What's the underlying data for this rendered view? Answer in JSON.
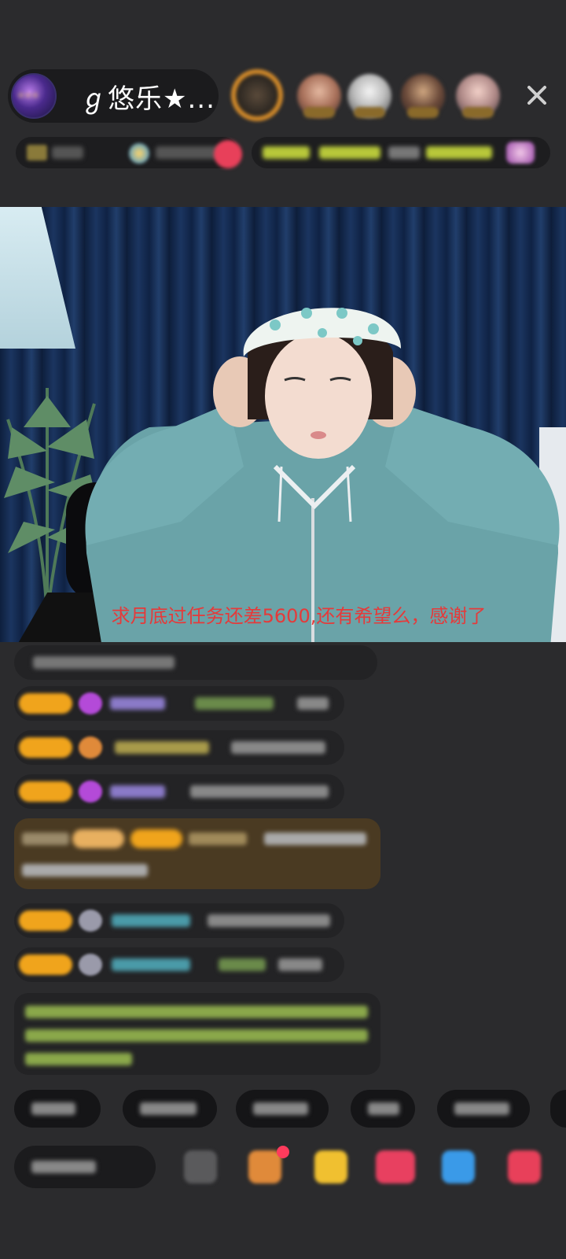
{
  "header": {
    "host_name": "ℊ悠乐★..."
  },
  "video": {
    "caption": "求月底过任务还差5600,还有希望么，感谢了"
  },
  "icons": {
    "close": "close-icon",
    "colors": {
      "level_badge": "#f0a41c",
      "caption_red": "#e53a3a",
      "chat_bubble": "#232325",
      "background": "#2b2b2d"
    }
  }
}
